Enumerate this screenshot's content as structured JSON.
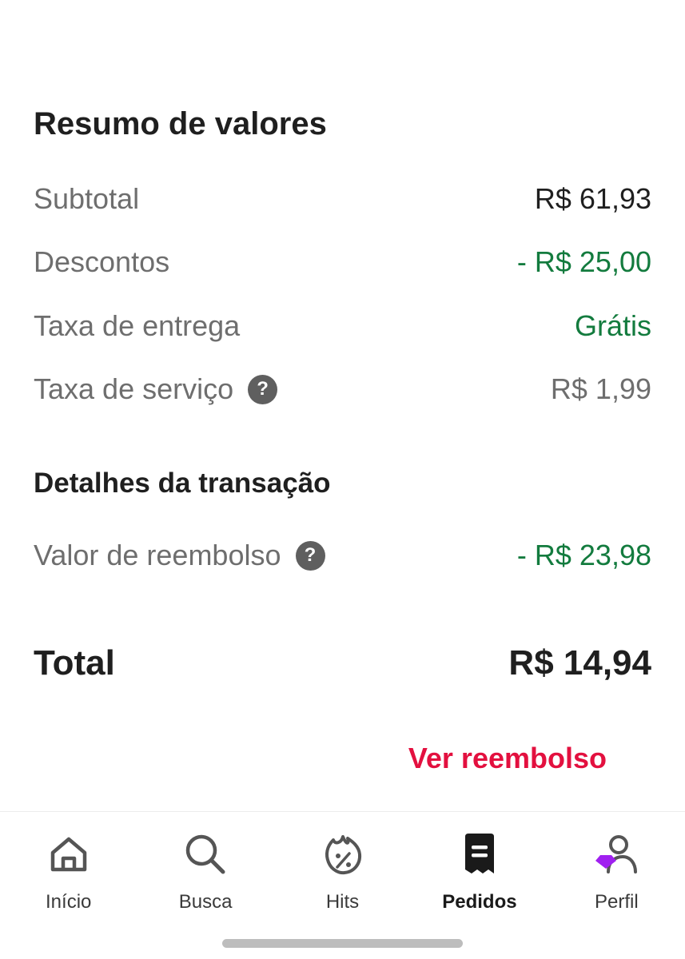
{
  "summary": {
    "title": "Resumo de valores",
    "rows": [
      {
        "label": "Subtotal",
        "value": "R$ 61,93"
      },
      {
        "label": "Descontos",
        "value": "- R$ 25,00"
      },
      {
        "label": "Taxa de entrega",
        "value": "Grátis"
      },
      {
        "label": "Taxa de serviço",
        "value": "R$ 1,99",
        "help_icon": "question-mark"
      }
    ]
  },
  "details": {
    "title": "Detalhes da transação",
    "refund_label": "Valor de reembolso",
    "refund_value": "- R$ 23,98",
    "help_icon": "question-mark"
  },
  "total": {
    "label": "Total",
    "value": "R$ 14,94"
  },
  "refund_link": "Ver reembolso",
  "help_glyph": "?",
  "colors": {
    "positive": "#137b3e",
    "link": "#e3103f",
    "profile_accent": "#a020f0"
  },
  "nav": {
    "active": "Pedidos",
    "items": [
      {
        "label": "Início",
        "icon": "home-icon"
      },
      {
        "label": "Busca",
        "icon": "search-icon"
      },
      {
        "label": "Hits",
        "icon": "flame-percent-icon"
      },
      {
        "label": "Pedidos",
        "icon": "receipt-icon"
      },
      {
        "label": "Perfil",
        "icon": "profile-icon"
      }
    ]
  }
}
